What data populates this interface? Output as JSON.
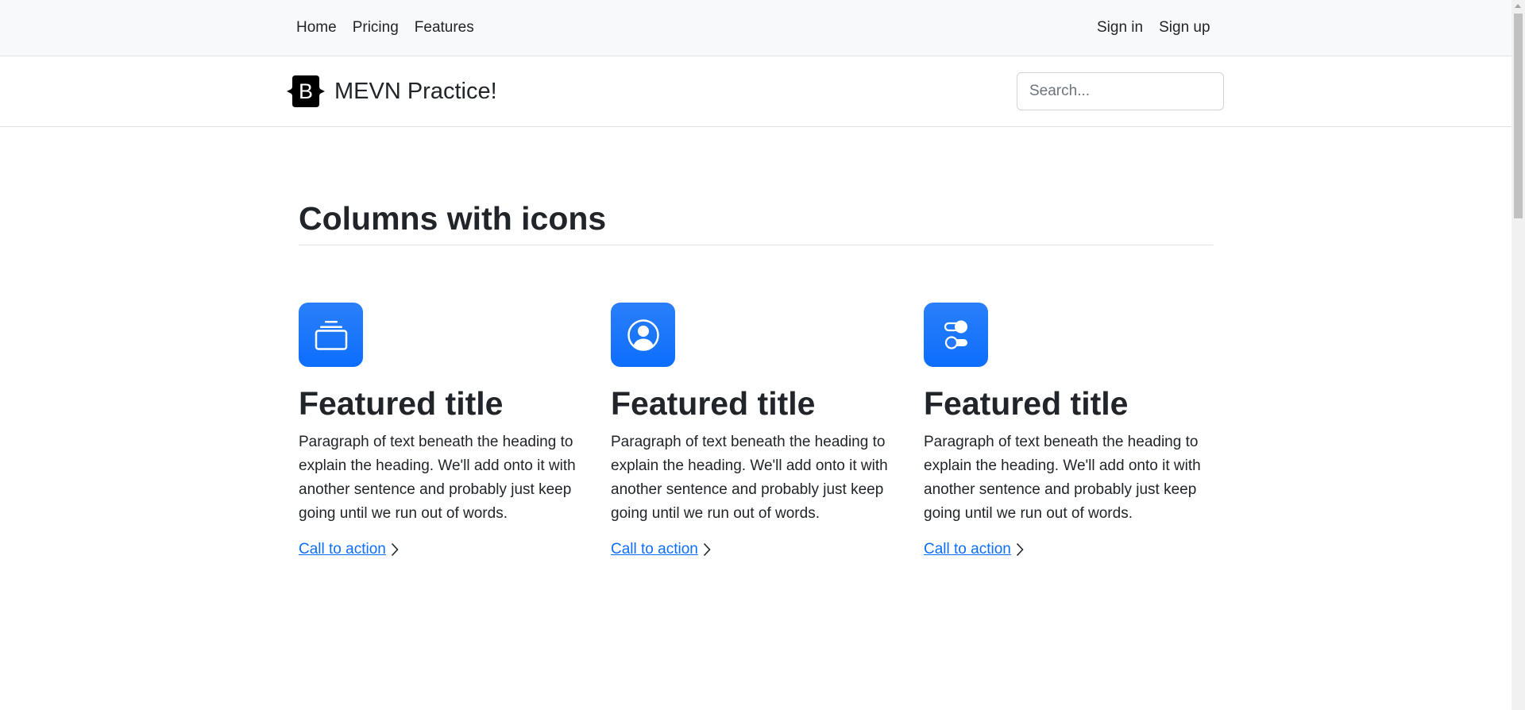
{
  "topnav": {
    "left_links": [
      {
        "label": "Home"
      },
      {
        "label": "Pricing"
      },
      {
        "label": "Features"
      }
    ],
    "right_links": [
      {
        "label": "Sign in"
      },
      {
        "label": "Sign up"
      }
    ]
  },
  "header": {
    "logo_letter": "B",
    "brand_name": "MEVN Practice!",
    "search_placeholder": "Search..."
  },
  "main": {
    "section_title": "Columns with icons",
    "features": [
      {
        "icon": "collection-icon",
        "title": "Featured title",
        "text": "Paragraph of text beneath the heading to explain the heading. We'll add onto it with another sentence and probably just keep going until we run out of words.",
        "cta": "Call to action"
      },
      {
        "icon": "person-circle-icon",
        "title": "Featured title",
        "text": "Paragraph of text beneath the heading to explain the heading. We'll add onto it with another sentence and probably just keep going until we run out of words.",
        "cta": "Call to action"
      },
      {
        "icon": "toggles-icon",
        "title": "Featured title",
        "text": "Paragraph of text beneath the heading to explain the heading. We'll add onto it with another sentence and probably just keep going until we run out of words.",
        "cta": "Call to action"
      }
    ]
  },
  "colors": {
    "accent": "#0d6efd",
    "nav_bg": "#f8f9fa",
    "text": "#212529",
    "border": "#dee2e6"
  }
}
